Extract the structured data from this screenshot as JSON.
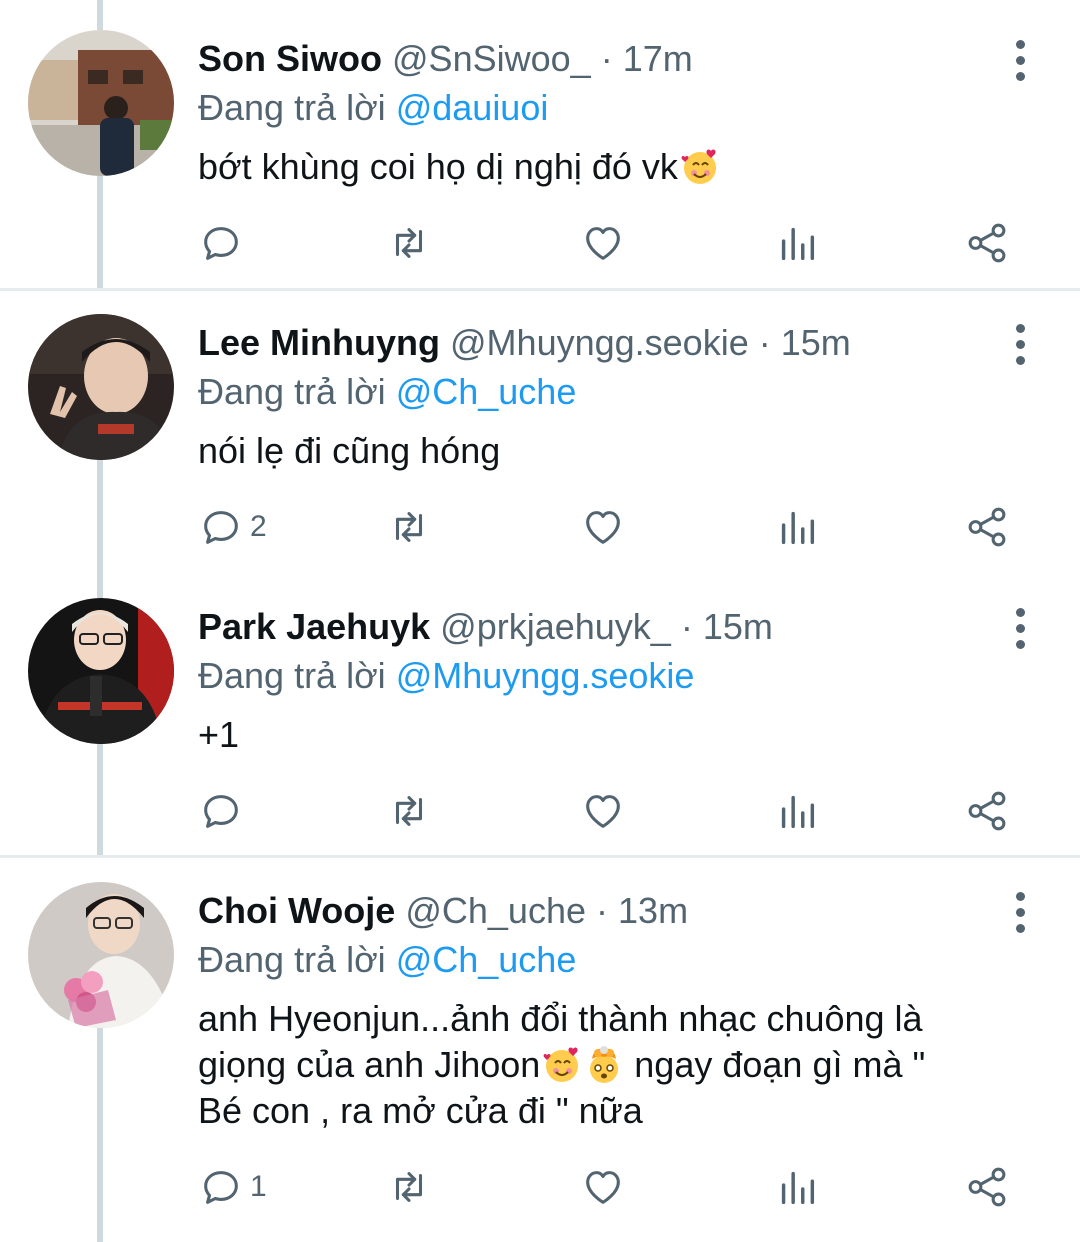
{
  "tweets": [
    {
      "name": "Son Siwoo",
      "handle": "@SnSiwoo_",
      "separator": "·",
      "time": "17m",
      "reply_prefix": "Đang trả lời",
      "reply_to": "@dauiuoi",
      "text": "bớt khùng coi họ dị nghị đó vk",
      "reply_count": "",
      "emojis": [
        "smiling-face-with-hearts"
      ]
    },
    {
      "name": "Lee Minhuyng",
      "handle": "@Mhuyngg.seokie",
      "separator": "·",
      "time": "15m",
      "reply_prefix": "Đang trả lời",
      "reply_to": "@Ch_uche",
      "text": "nói lẹ đi cũng hóng",
      "reply_count": "2"
    },
    {
      "name": "Park Jaehuyk",
      "handle": "@prkjaehuyk_",
      "separator": "·",
      "time": "15m",
      "reply_prefix": "Đang trả lời",
      "reply_to": "@Mhuyngg.seokie",
      "text": "+1",
      "reply_count": ""
    },
    {
      "name": "Choi Wooje",
      "handle": "@Ch_uche",
      "separator": "·",
      "time": "13m",
      "reply_prefix": "Đang trả lời",
      "reply_to": "@Ch_uche",
      "text_line1": "anh Hyeonjun...ảnh đổi thành nhạc chuông là",
      "text_line2a": "giọng của anh Jihoon",
      "text_line2b": " ngay đoạn gì mà \"",
      "text_line3": "Bé con , ra mở cửa đi \" nữa",
      "reply_count": "1",
      "emojis": [
        "smiling-face-with-hearts",
        "exploding-head"
      ]
    }
  ],
  "colors": {
    "accent": "#1d9bf0",
    "secondary_text": "#536471",
    "primary_text": "#0f1419",
    "divider": "#e6ebee"
  }
}
